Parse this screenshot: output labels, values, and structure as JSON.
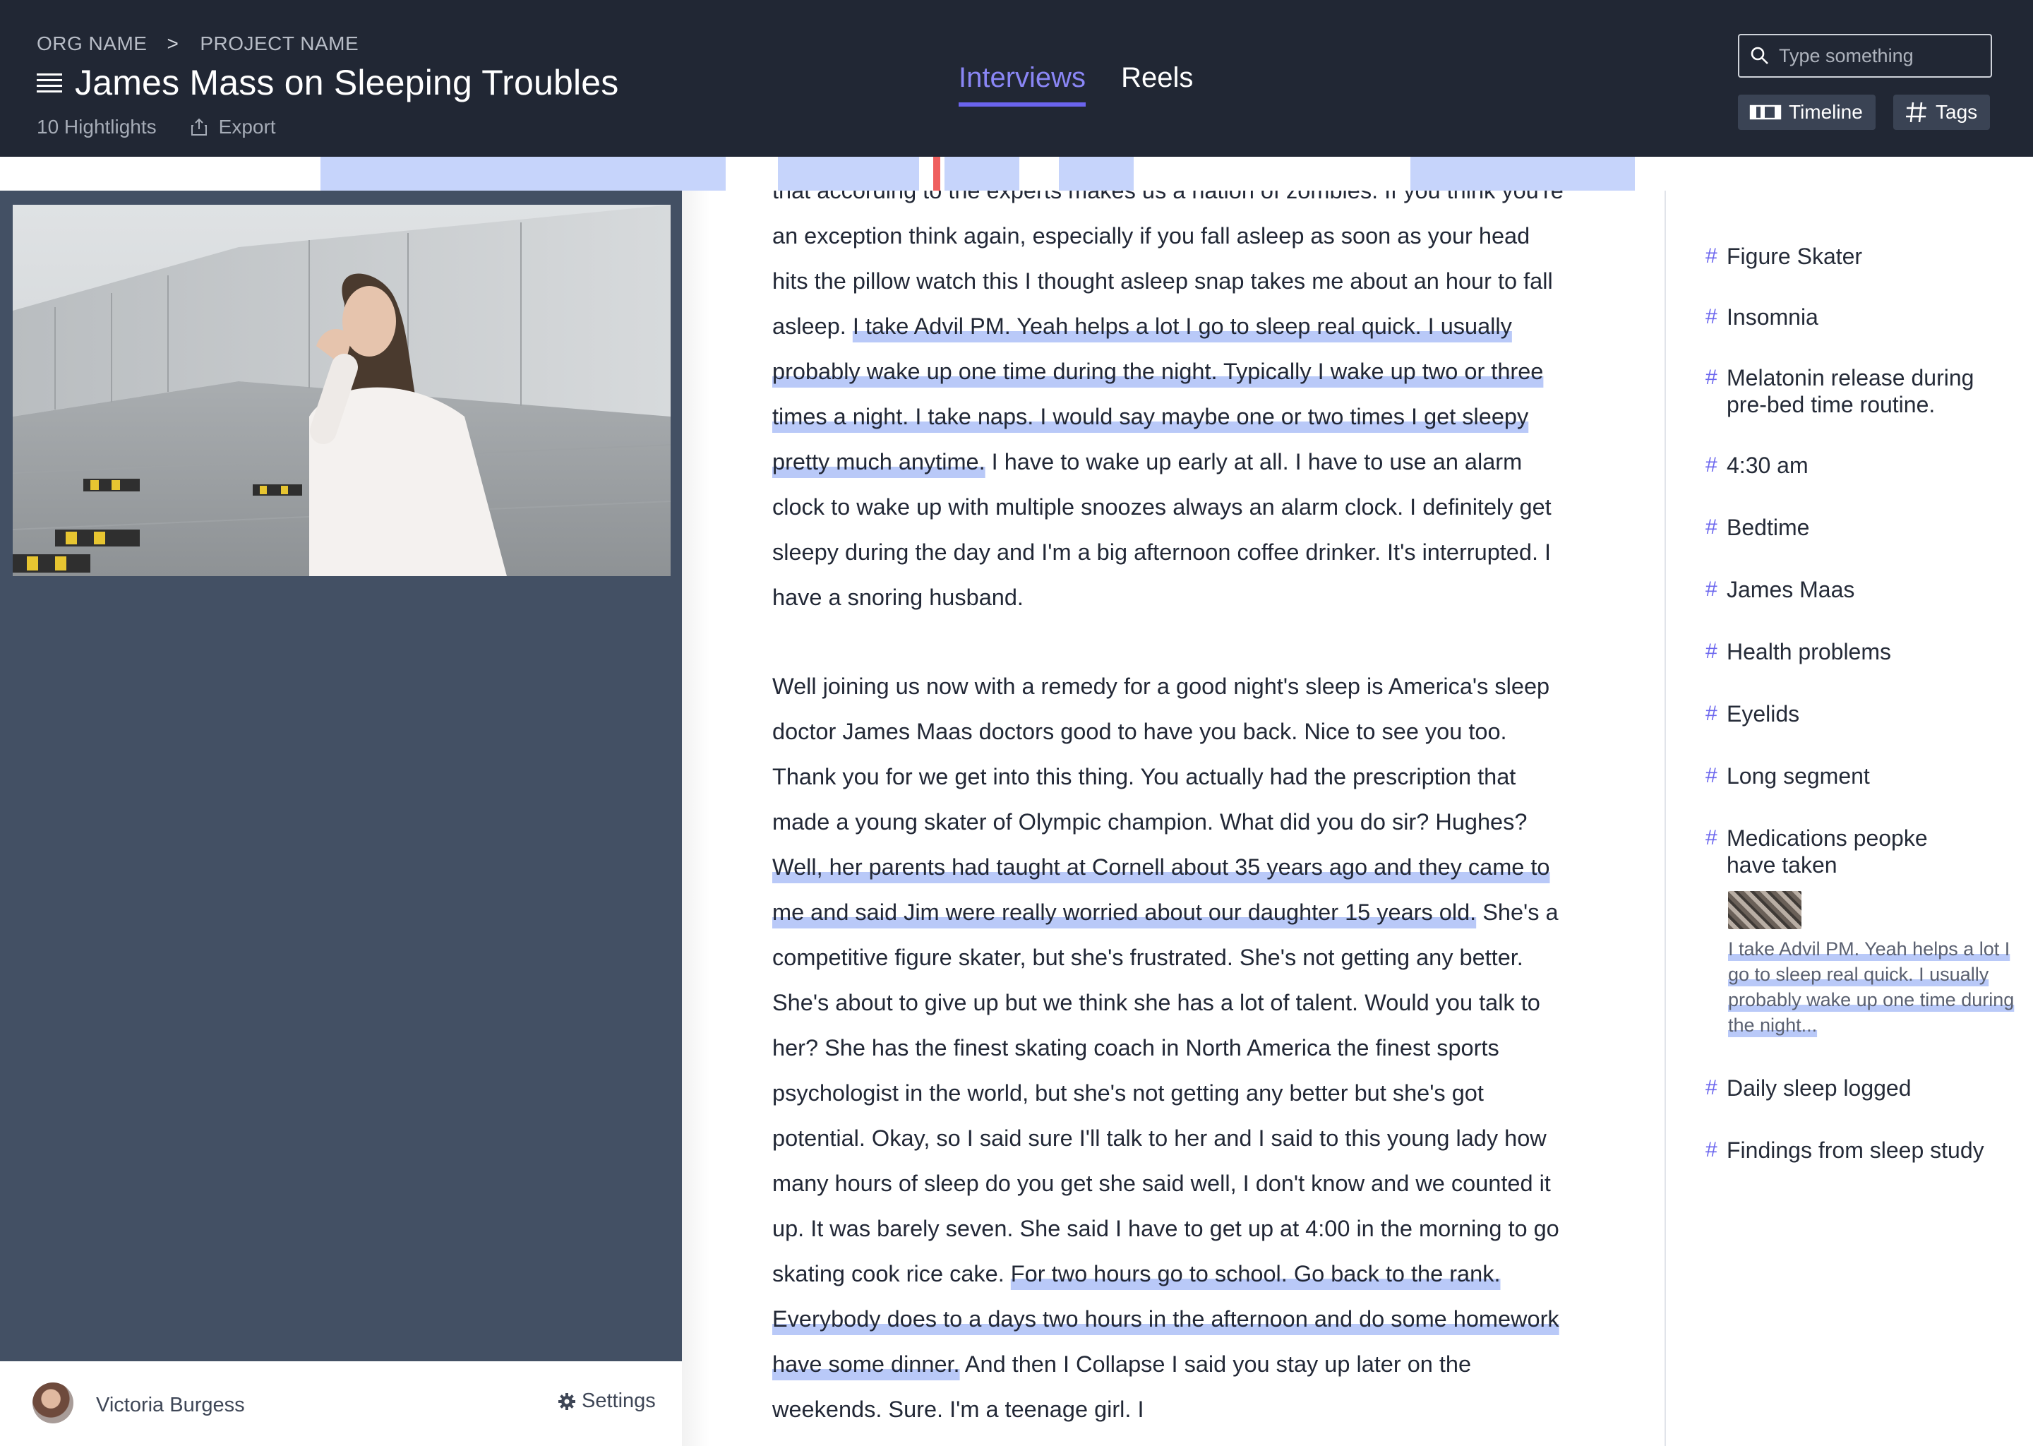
{
  "header": {
    "org_name": "ORG NAME",
    "breadcrumb_separator": ">",
    "project_name": "PROJECT NAME",
    "title": "James Mass on Sleeping Troubles",
    "highlights_count": "10 Hightlights",
    "export_label": "Export",
    "tabs": [
      {
        "label": "Interviews",
        "active": true
      },
      {
        "label": "Reels",
        "active": false
      }
    ],
    "search_placeholder": "Type something",
    "timeline_label": "Timeline",
    "tags_label": "Tags"
  },
  "colors": {
    "header_bg": "#212734",
    "accent": "#6b64ee",
    "highlight": "#c6d4fb",
    "playhead": "#ef5f5f",
    "video_panel_bg": "#435064"
  },
  "user": {
    "name": "Victoria Burgess",
    "settings_label": "Settings"
  },
  "transcript": {
    "p1": {
      "a": "that according to the experts makes us a nation of zombies. If you think you're an exception think again, especially if you fall asleep as soon as your head hits the pillow watch this I thought asleep snap takes me about an hour to fall asleep. ",
      "h1": "I take Advil PM. Yeah helps a lot I go to sleep real quick. I usually probably wake up one time during the night. Typically I wake up two or three times a night. I take naps. I would say maybe one or two times I get sleepy pretty much anytime.",
      "b": " I have to wake up early at all. I have to use an alarm clock to wake up with multiple snoozes always an alarm clock. I definitely get sleepy during the day and I'm a big afternoon coffee drinker. It's interrupted. I have a snoring husband."
    },
    "p2": {
      "a": "Well joining us now with a remedy for a good night's sleep is America's sleep doctor James Maas doctors good to have you back. Nice to see you too. Thank you for we get into this thing. You actually had the prescription that made a young skater of Olympic champion. What did you do sir? Hughes? ",
      "h1": "Well, her parents had taught at Cornell about 35 years ago and they came to me and said Jim were really worried about our daughter 15 years old.",
      "b": " She's a competitive figure skater, but she's frustrated. She's not getting any better. She's about to give up but we think she has a lot of talent. Would you talk to her? She has the finest skating coach in North America the finest sports psychologist in the world, but she's not getting any better but she's got potential. Okay, so I said sure I'll talk to her and I said to this young lady how many hours of sleep do you get she said well, I don't know and we counted it up. It was barely seven. She said I have to get up at 4:00 in the morning to go skating cook rice cake. ",
      "h2": "For two hours go to school. Go back to the rank. Everybody does to a days two hours in the afternoon and do some homework have some dinner.",
      "c": " And then I Collapse I said you stay up later on the weekends. Sure. I'm a teenage girl. I"
    }
  },
  "tags": [
    {
      "label": "Figure Skater"
    },
    {
      "label": "Insomnia"
    },
    {
      "label": "Melatonin release during pre-bed time routine."
    },
    {
      "label": "4:30 am"
    },
    {
      "label": "Bedtime"
    },
    {
      "label": "James Maas"
    },
    {
      "label": "Health problems"
    },
    {
      "label": "Eyelids"
    },
    {
      "label": "Long segment"
    },
    {
      "label": "Medications peopke have taken"
    },
    {
      "label": "Daily sleep logged"
    },
    {
      "label": "Findings from sleep study"
    }
  ],
  "tag_quote": "I take Advil PM. Yeah helps a lot I go to sleep real quick. I usually probably wake up one time during the night..."
}
